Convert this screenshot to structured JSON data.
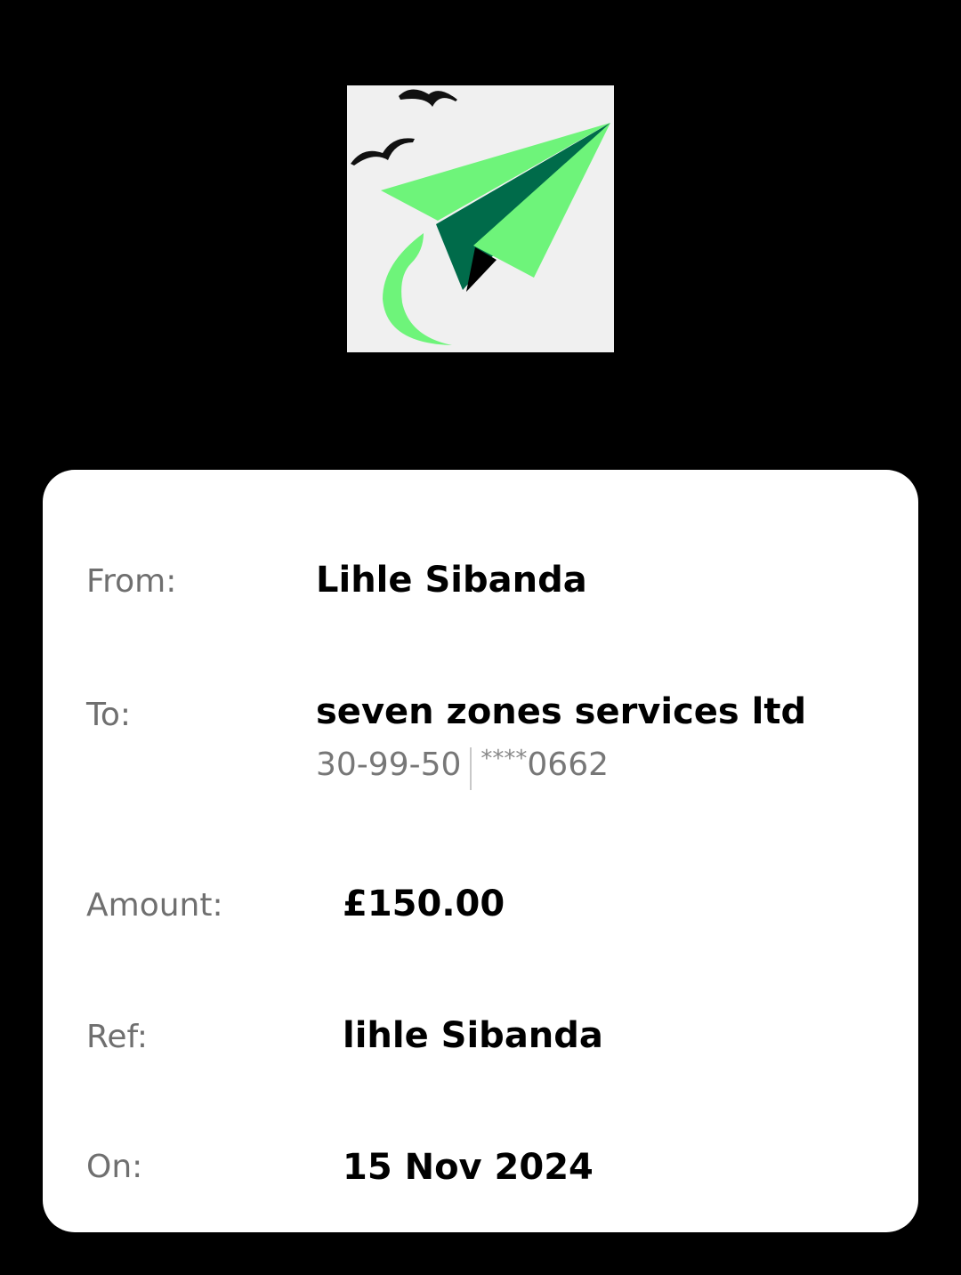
{
  "logo": {
    "icon": "paper-plane-icon",
    "colors": {
      "light_green": "#6ef47a",
      "dark_green": "#006b4a",
      "tail": "#000000"
    }
  },
  "receipt": {
    "from_label": "From:",
    "from_value": "Lihle Sibanda",
    "to_label": "To:",
    "to_value": "seven zones services ltd",
    "sort_code": "30-99-50",
    "account_mask": "****",
    "account_last4": "0662",
    "amount_label": "Amount:",
    "amount_value": "£150.00",
    "ref_label": "Ref:",
    "ref_value": "lihle Sibanda",
    "on_label": "On:",
    "on_value": "15 Nov 2024"
  }
}
